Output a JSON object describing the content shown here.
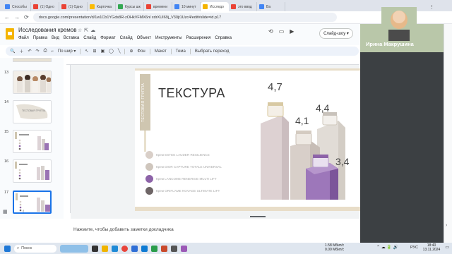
{
  "browser": {
    "tabs": [
      {
        "label": "Способы",
        "color": "#4285f4"
      },
      {
        "label": "(1) Одно",
        "color": "#ea4335"
      },
      {
        "label": "(1) Одно",
        "color": "#ea4335"
      },
      {
        "label": "Карточка",
        "color": "#fbbc04"
      },
      {
        "label": "Курсы шк",
        "color": "#34a853"
      },
      {
        "label": "времени",
        "color": "#ea4335"
      },
      {
        "label": "10 минут",
        "color": "#4285f4"
      },
      {
        "label": "Исследо",
        "color": "#f4b400"
      },
      {
        "label": "это ввод",
        "color": "#ea4335"
      },
      {
        "label": "Ва",
        "color": "#4285f4"
      }
    ],
    "url": "docs.google.com/presentation/d/1w1Cb1YGds8R-zOHkVFMX6nl xdrXUI69j_V30jt1Uzc4/edit#slide=id.p17"
  },
  "app": {
    "title": "Исследования кремов",
    "menu": [
      "Файл",
      "Правка",
      "Вид",
      "Вставка",
      "Слайд",
      "Формат",
      "Слайд",
      "Объект",
      "Инструменты",
      "Расширения",
      "Справка"
    ],
    "slideshow_label": "Слайд-шоу",
    "toolbar": {
      "zoom": "По шир",
      "background": "Фон",
      "layout": "Макет",
      "theme": "Тема",
      "transition": "Выбрать переход"
    }
  },
  "thumbnails": [
    {
      "num": "13"
    },
    {
      "num": "14",
      "caption": "ТЕСТОВАЯ ГРУППА"
    },
    {
      "num": "15"
    },
    {
      "num": "16"
    },
    {
      "num": "17"
    }
  ],
  "slide": {
    "tag": "ТЕСТОВАЯ ГРУППА",
    "title": "ТЕКСТУРА",
    "legend": [
      {
        "label": "Крем ESTEE LAUDER RESILIENCE",
        "color": "#d9cfc8"
      },
      {
        "label": "Крем DIOR CAPTURE TOTALE UNIVERSAL",
        "color": "#cfc6bd"
      },
      {
        "label": "Крем LANCOME RENERGIE MULTI LIFT",
        "color": "#8d63a8"
      },
      {
        "label": "Крем ORIFLAME NOVAGE ULTIMATE LIFT",
        "color": "#6e6566"
      }
    ],
    "values": [
      {
        "label": "4,7",
        "value": 4.7
      },
      {
        "label": "4,1",
        "value": 4.1
      },
      {
        "label": "4,4",
        "value": 4.4
      },
      {
        "label": "3,4",
        "value": 3.4
      }
    ]
  },
  "notes": "Нажмите, чтобы добавить заметки докладчика",
  "meet": {
    "participant": "Ирина Макрушина"
  },
  "taskbar": {
    "search": "Поиск",
    "lang": "РУС",
    "time": "18:40",
    "date": "13.11.2024",
    "net_up": "1.58 Мбит/с",
    "net_down": "0.00 Мбит/с"
  }
}
